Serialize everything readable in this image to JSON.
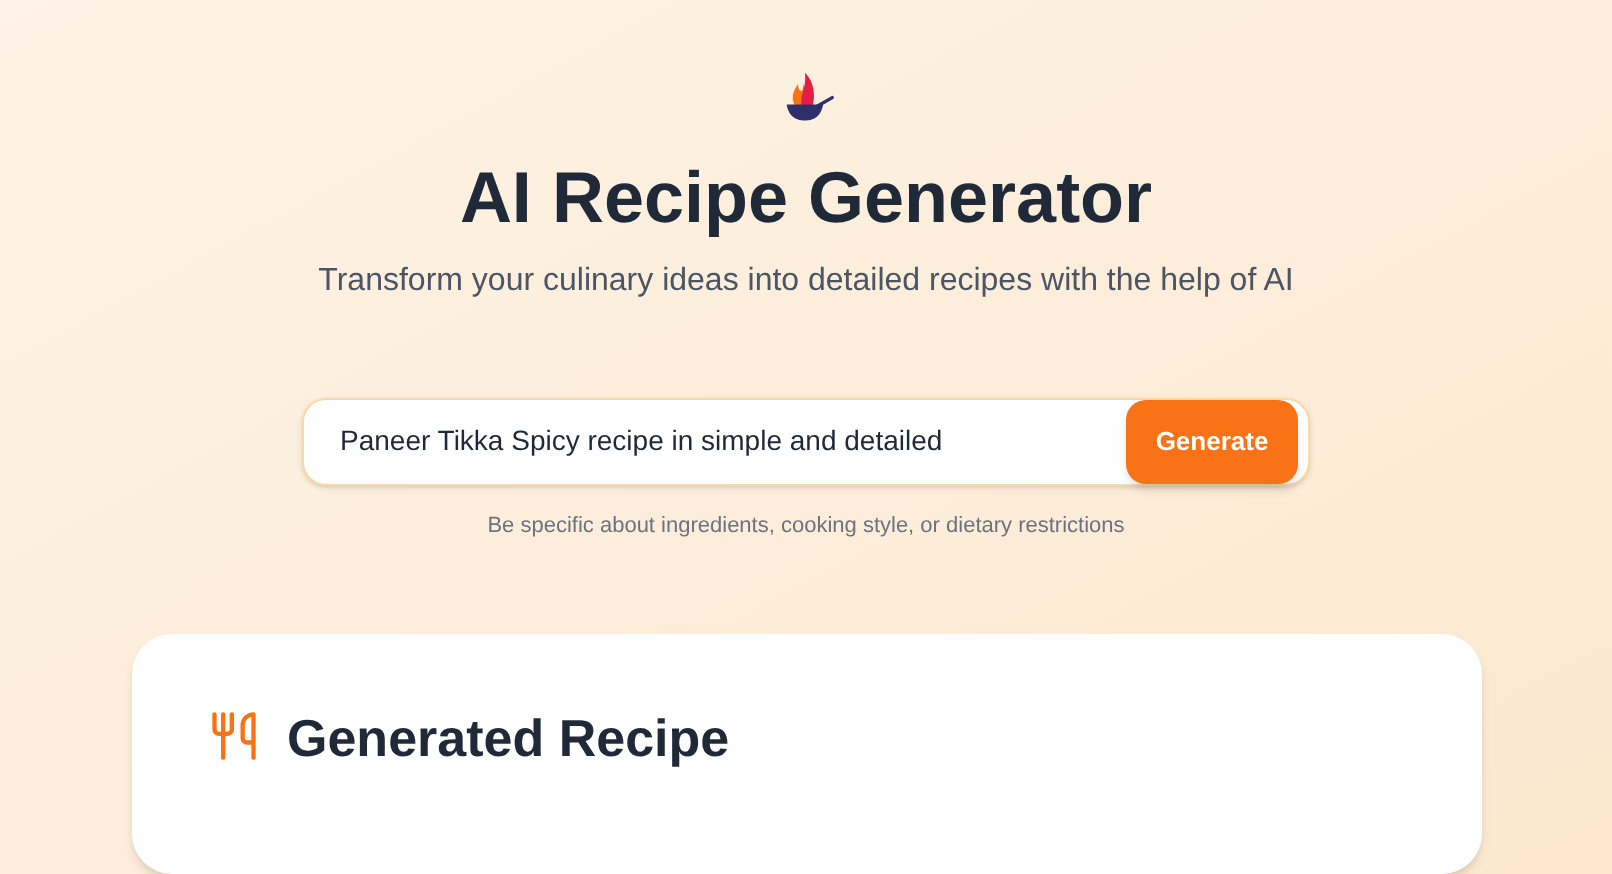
{
  "header": {
    "title": "AI Recipe Generator",
    "subtitle": "Transform your culinary ideas into detailed recipes with the help of AI"
  },
  "prompt": {
    "value": "Paneer Tikka Spicy recipe in simple and detailed",
    "button": "Generate",
    "hint": "Be specific about ingredients, cooking style, or dietary restrictions"
  },
  "result": {
    "title": "Generated Recipe"
  }
}
